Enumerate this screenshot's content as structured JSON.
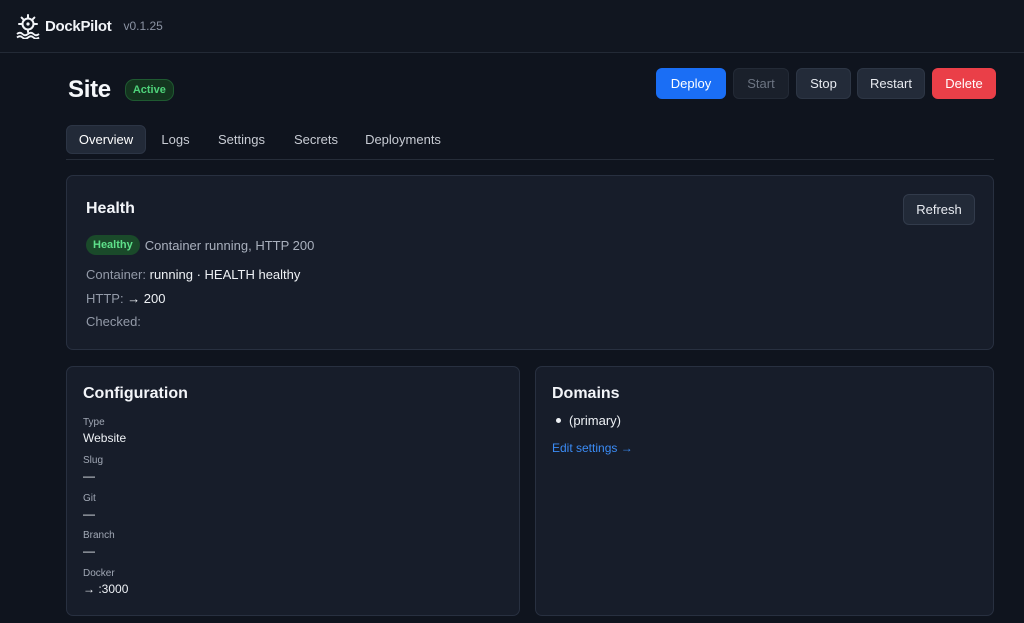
{
  "app": {
    "name": "DockPilot",
    "version": "v0.1.25"
  },
  "page": {
    "title": "Site",
    "status": "Active"
  },
  "actions": {
    "deploy": "Deploy",
    "start": "Start",
    "stop": "Stop",
    "restart": "Restart",
    "delete": "Delete"
  },
  "tabs": [
    {
      "label": "Overview",
      "active": true
    },
    {
      "label": "Logs",
      "active": false
    },
    {
      "label": "Settings",
      "active": false
    },
    {
      "label": "Secrets",
      "active": false
    },
    {
      "label": "Deployments",
      "active": false
    }
  ],
  "health": {
    "title": "Health",
    "refresh_label": "Refresh",
    "badge": "Healthy",
    "summary": "Container running, HTTP 200",
    "container_label": "Container:",
    "container_value": "running · HEALTH healthy",
    "http_label": "HTTP:",
    "http_value": "→ 200",
    "checked_label": "Checked:",
    "checked_value": ""
  },
  "configuration": {
    "title": "Configuration",
    "fields": [
      {
        "label": "Type",
        "value": "Website"
      },
      {
        "label": "Slug",
        "value": "—"
      },
      {
        "label": "Git",
        "value": "—"
      },
      {
        "label": "Branch",
        "value": "—"
      },
      {
        "label": "Docker",
        "value": "→ :3000"
      }
    ]
  },
  "domains": {
    "title": "Domains",
    "items": [
      "(primary)"
    ],
    "edit_link": "Edit settings →"
  },
  "colors": {
    "background": "#0f141e",
    "card": "#171d2a",
    "primary": "#1a6ef5",
    "danger": "#ea3f48",
    "success": "#4ed27a",
    "link": "#3b8cf6"
  },
  "icons": {
    "logo": "ship-wheel-icon"
  }
}
